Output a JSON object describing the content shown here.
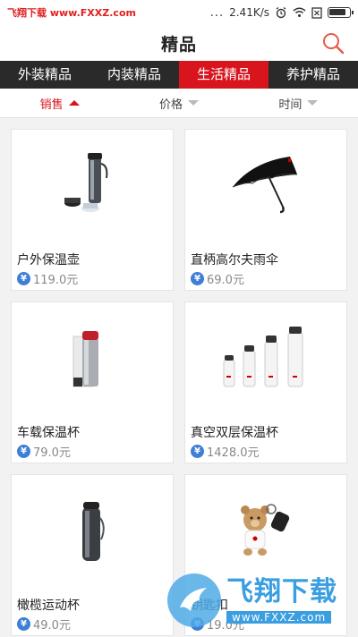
{
  "status_bar": {
    "watermark": "飞翔下载 www.FXXZ.com",
    "signal": "...",
    "speed": "2.41K/s"
  },
  "header": {
    "title": "精品"
  },
  "tabs": [
    {
      "label": "外装精品",
      "active": false
    },
    {
      "label": "内装精品",
      "active": false
    },
    {
      "label": "生活精品",
      "active": true
    },
    {
      "label": "养护精品",
      "active": false
    }
  ],
  "sort": [
    {
      "label": "销售",
      "active": true
    },
    {
      "label": "价格",
      "active": false
    },
    {
      "label": "时间",
      "active": false
    }
  ],
  "products": [
    {
      "name": "户外保温壶",
      "price": "119.0元",
      "icon": "thermos-kit"
    },
    {
      "name": "直柄高尔夫雨伞",
      "price": "69.0元",
      "icon": "umbrella"
    },
    {
      "name": "车载保温杯",
      "price": "79.0元",
      "icon": "car-tumbler"
    },
    {
      "name": "真空双层保温杯",
      "price": "1428.0元",
      "icon": "bottle-set"
    },
    {
      "name": "橄榄运动杯",
      "price": "49.0元",
      "icon": "sport-cup"
    },
    {
      "name": "钥匙扣",
      "price": "19.0元",
      "icon": "bear-keychain"
    }
  ],
  "currency_symbol": "¥",
  "watermark_bottom": {
    "main": "飞翔下载",
    "sub": "www.FXXZ.com"
  },
  "colors": {
    "accent": "#d8141c",
    "tab_bar": "#2a2a2a",
    "currency": "#3e7fd6"
  }
}
